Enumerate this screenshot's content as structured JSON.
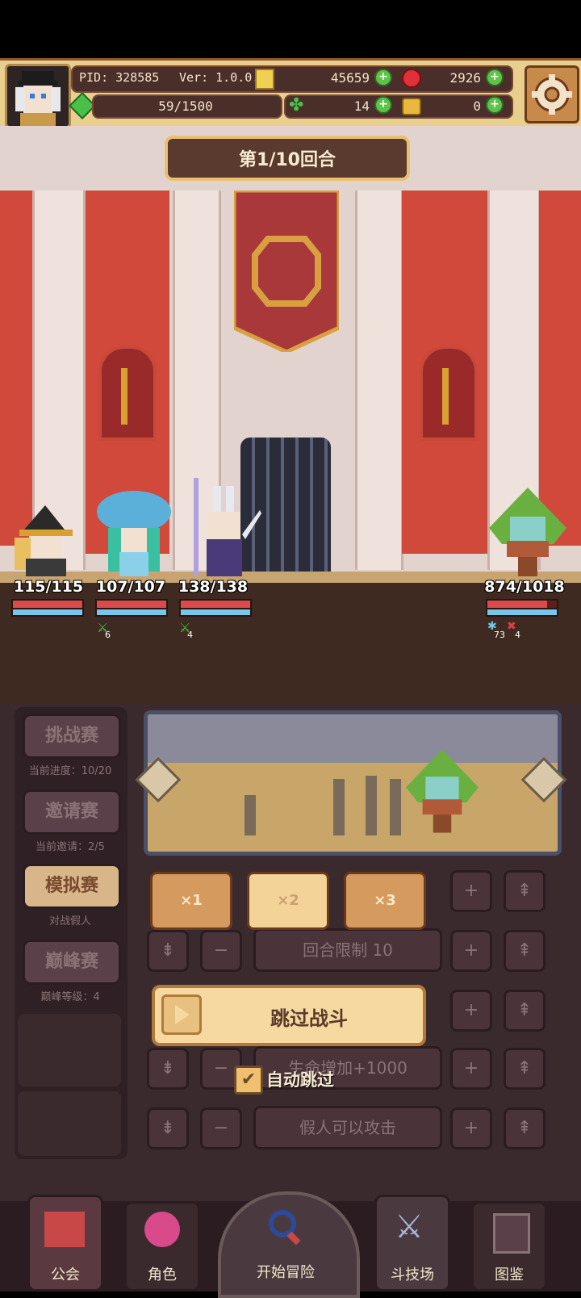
{
  "hud": {
    "pid": "PID: 328585",
    "version": "Ver: 1.0.0.3",
    "gold": "45659",
    "gems": "2926",
    "energy": "59/1500",
    "clover": "14",
    "key": "0",
    "avatar_icon": "hero-portrait",
    "settings_icon": "gear-icon"
  },
  "battle": {
    "round_label": "第1/10回合",
    "allies": [
      {
        "hp": "115/115",
        "hp_frac": 1.0,
        "buff": ""
      },
      {
        "hp": "107/107",
        "hp_frac": 1.0,
        "buff": "6"
      },
      {
        "hp": "138/138",
        "hp_frac": 1.0,
        "buff": "4"
      }
    ],
    "enemy": {
      "hp": "874/1018",
      "hp_frac": 0.8585,
      "buff1": "73",
      "buff2": "4"
    }
  },
  "sidebar": {
    "items": [
      {
        "label": "挑战赛",
        "caption": "当前进度：10/20"
      },
      {
        "label": "邀请赛",
        "caption": "当前邀请：2/5"
      },
      {
        "label": "模拟赛",
        "caption": "对战假人"
      },
      {
        "label": "巅峰赛",
        "caption": "巅峰等级：4"
      }
    ]
  },
  "controls": {
    "speeds": [
      "×1",
      "×2",
      "×3"
    ],
    "rows": [
      "回合限制 10",
      "生命增加+1000",
      "假人可以攻击"
    ],
    "skip_label": "跳过战斗",
    "auto_skip_label": "自动跳过",
    "auto_skip_checked": true
  },
  "nav": {
    "items": [
      "公会",
      "角色",
      "开始冒险",
      "斗技场",
      "图鉴"
    ]
  },
  "colors": {
    "hud_bg": "#e8cf8e",
    "hp_red": "#d84c4c",
    "mp_blue": "#79c6e8",
    "panel_bg": "#3a2a2d"
  }
}
